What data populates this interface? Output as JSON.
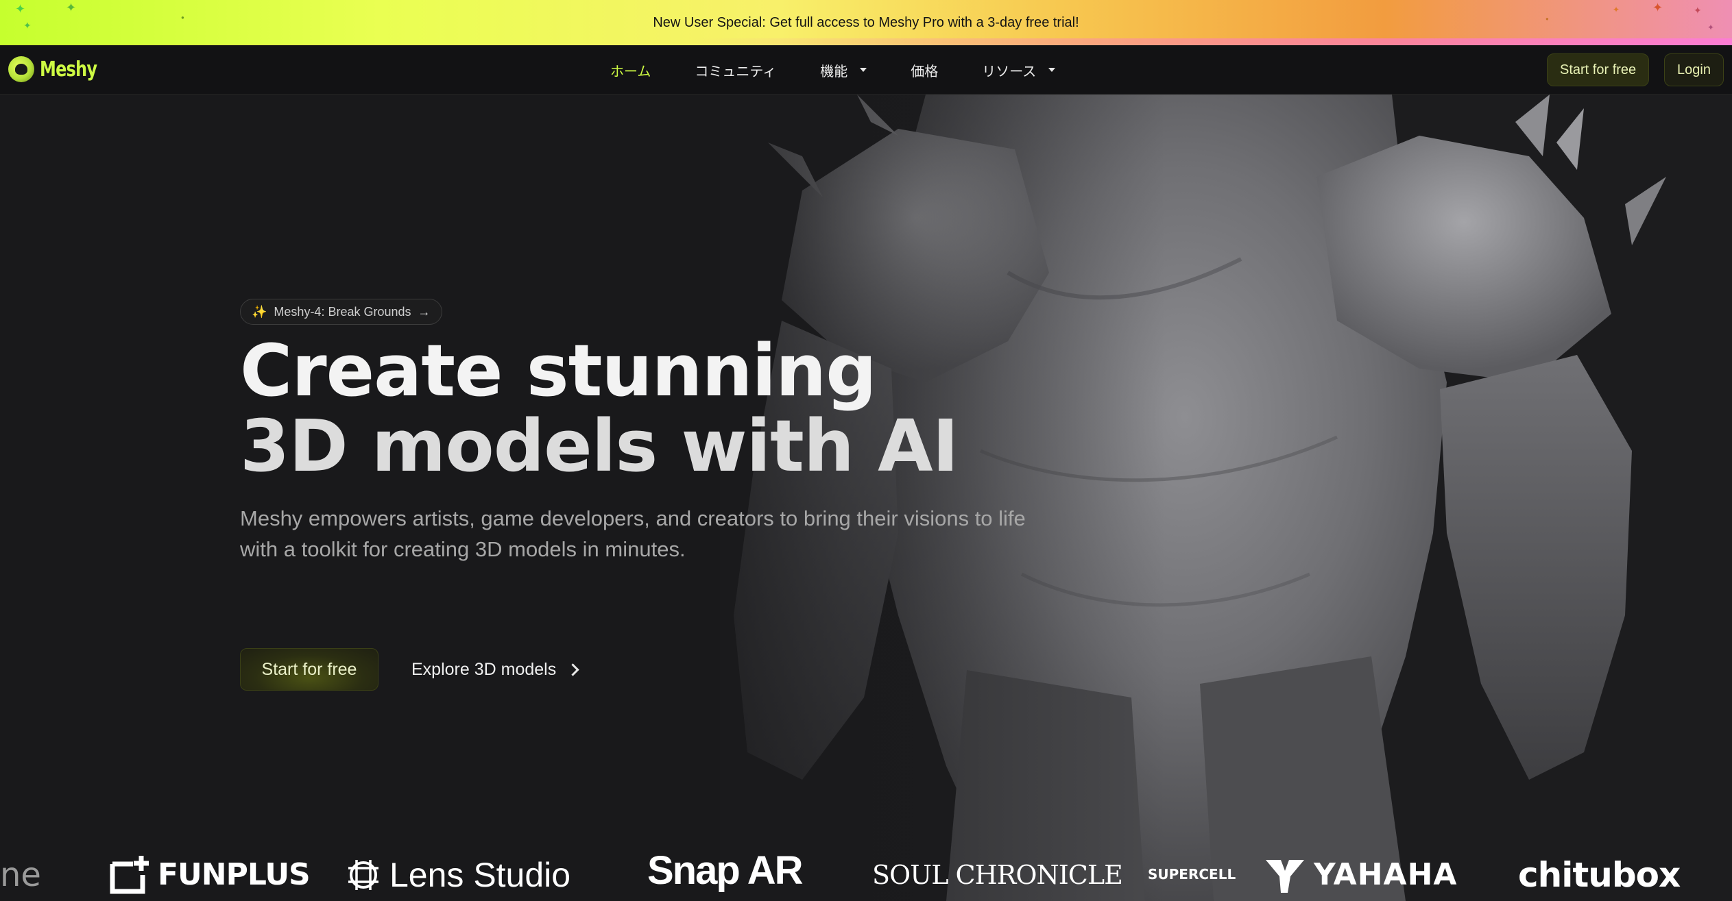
{
  "promo": {
    "text": "New User Special: Get full access to Meshy Pro with a 3-day free trial!"
  },
  "brand": {
    "name": "Meshy",
    "accent": "#cdfa43"
  },
  "nav": {
    "items": [
      {
        "label": "ホーム",
        "active": true,
        "dropdown": false
      },
      {
        "label": "コミュニティ",
        "active": false,
        "dropdown": false
      },
      {
        "label": "機能",
        "active": false,
        "dropdown": true
      },
      {
        "label": "価格",
        "active": false,
        "dropdown": false
      },
      {
        "label": "リソース",
        "active": false,
        "dropdown": true
      }
    ],
    "start_label": "Start for free",
    "login_label": "Login"
  },
  "hero": {
    "badge": "Meshy-4: Break Grounds",
    "title_line1": "Create stunning",
    "title_line2": "3D models with AI",
    "subtitle": "Meshy empowers artists, game developers, and creators to bring their visions to life with a toolkit for creating 3D models in minutes.",
    "primary_cta": "Start for free",
    "secondary_cta": "Explore 3D models"
  },
  "partners": {
    "logos": [
      "ne",
      "FUNPLUS",
      "Lens Studio",
      "Snap AR",
      "SOUL CHRONICLE",
      "SUPERCELL",
      "YAHAHA",
      "chitubox"
    ]
  }
}
